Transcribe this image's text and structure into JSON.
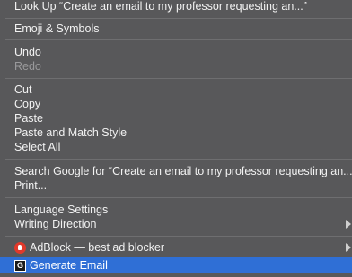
{
  "menu": {
    "look_up": "Look Up “Create an email to my professor requesting an...”",
    "emoji": "Emoji & Symbols",
    "undo": "Undo",
    "redo": "Redo",
    "cut": "Cut",
    "copy": "Copy",
    "paste": "Paste",
    "paste_match": "Paste and Match Style",
    "select_all": "Select All",
    "search_google": "Search Google for “Create an email to my professor requesting an...”",
    "print": "Print...",
    "language_settings": "Language Settings",
    "writing_direction": "Writing Direction",
    "adblock": "AdBlock — best ad blocker",
    "generate_email": "Generate Email",
    "generate_icon_letter": "G"
  },
  "colors": {
    "highlight": "#2f6fd6",
    "adblock_red": "#e1392b"
  }
}
